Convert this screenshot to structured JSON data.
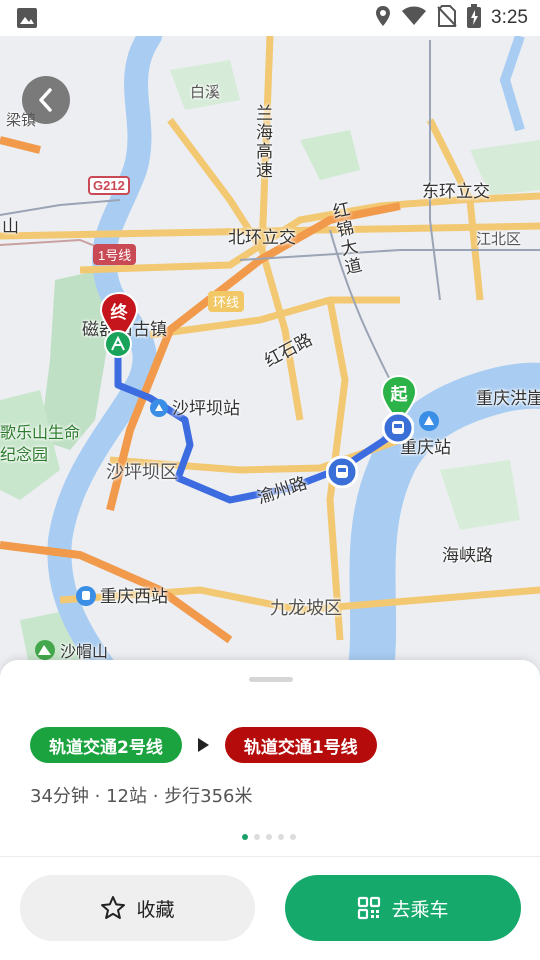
{
  "status_bar": {
    "time": "3:25"
  },
  "map": {
    "labels": {
      "baixi": "白溪",
      "liangzhen": "梁镇",
      "shan": "山",
      "lanhai": "兰海高速",
      "dongxiao": "东环立交",
      "beixiao": "北环立交",
      "hongjin": "红锦大道",
      "jiangbei": "江北区",
      "huanxian": "环线",
      "ciqi": "磁器口古镇",
      "hongshi": "红石路",
      "shapingba_station": "沙坪坝站",
      "gele": "歌乐山生命纪念园",
      "shapingba_district": "沙坪坝区",
      "chongqing_station": "重庆站",
      "chongqing_hong": "重庆洪崖",
      "yuzhou": "渝州路",
      "haixia": "海峡路",
      "chongqing_west": "重庆西站",
      "jiulongpo": "九龙坡区",
      "shamao": "沙帽山",
      "g212": "G212",
      "line1_tag": "1号线",
      "start_marker": "起",
      "end_marker": "终"
    }
  },
  "route": {
    "segments": [
      {
        "label": "轨道交通2号线",
        "color": "#1aa33e"
      },
      {
        "label": "轨道交通1号线",
        "color": "#b50b0b"
      }
    ],
    "summary": "34分钟 · 12站 · 步行356米",
    "page_count": 5,
    "active_page": 1
  },
  "actions": {
    "favorite_label": "收藏",
    "go_label": "去乘车"
  },
  "colors": {
    "accent": "#16a96c",
    "route_blue": "#3d6be0"
  }
}
